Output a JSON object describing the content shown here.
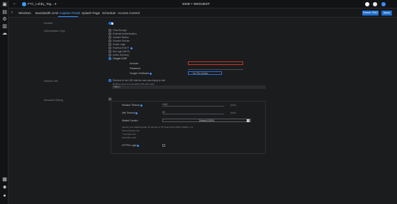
{
  "topbar": {
    "site_name": "FTC_Lobby_Tag... ▾",
    "title": "SSID • SNGUEST"
  },
  "tabs": [
    "Wireless",
    "Bandwidth Limit",
    "Captive Portal",
    "Splash Page",
    "Schedule",
    "Access Control"
  ],
  "actions": {
    "delete_label": "Delete SSID",
    "apply_label": "Apply"
  },
  "form": {
    "enabled_label": "Enabled",
    "auth_label": "Authentication Type",
    "auth_options": [
      "Click-through",
      "External Authentication",
      "Custom Radius",
      "Voucher Service",
      "Social Login",
      "Facebook Wi-Fi",
      "My Login (Wi-Fi)",
      "Active Directory",
      "Google LDAP"
    ],
    "account_label": "Account",
    "password_label": "Password",
    "cert_label": "Google Certificate",
    "upload_label": "No File Upload",
    "redirect_label": "Redirect URL",
    "redirect_option": "Redirect to the URL that the user was trying to visit",
    "redirect_hint": "Redirect users to a specified URL after login",
    "redirect_placeholder": "https://",
    "advanced_label": "Advanced Setting",
    "session_timeout_label": "Session Timeout",
    "session_timeout_value": "1440",
    "session_unit": "(min)",
    "idle_timeout_label": "Idle Timeout",
    "idle_timeout_value": "60",
    "idle_unit": "(min)",
    "walled_label": "Walled Garden",
    "walled_value": "Default (1000)",
    "walled_hint": "Specify your walled garden by domain or IP range using CIDR notation. e.g.",
    "walled_examples": [
      "www.example.com",
      "*.example.com",
      "192.168.1.1/24"
    ],
    "https_label": "HTTPS Login"
  }
}
